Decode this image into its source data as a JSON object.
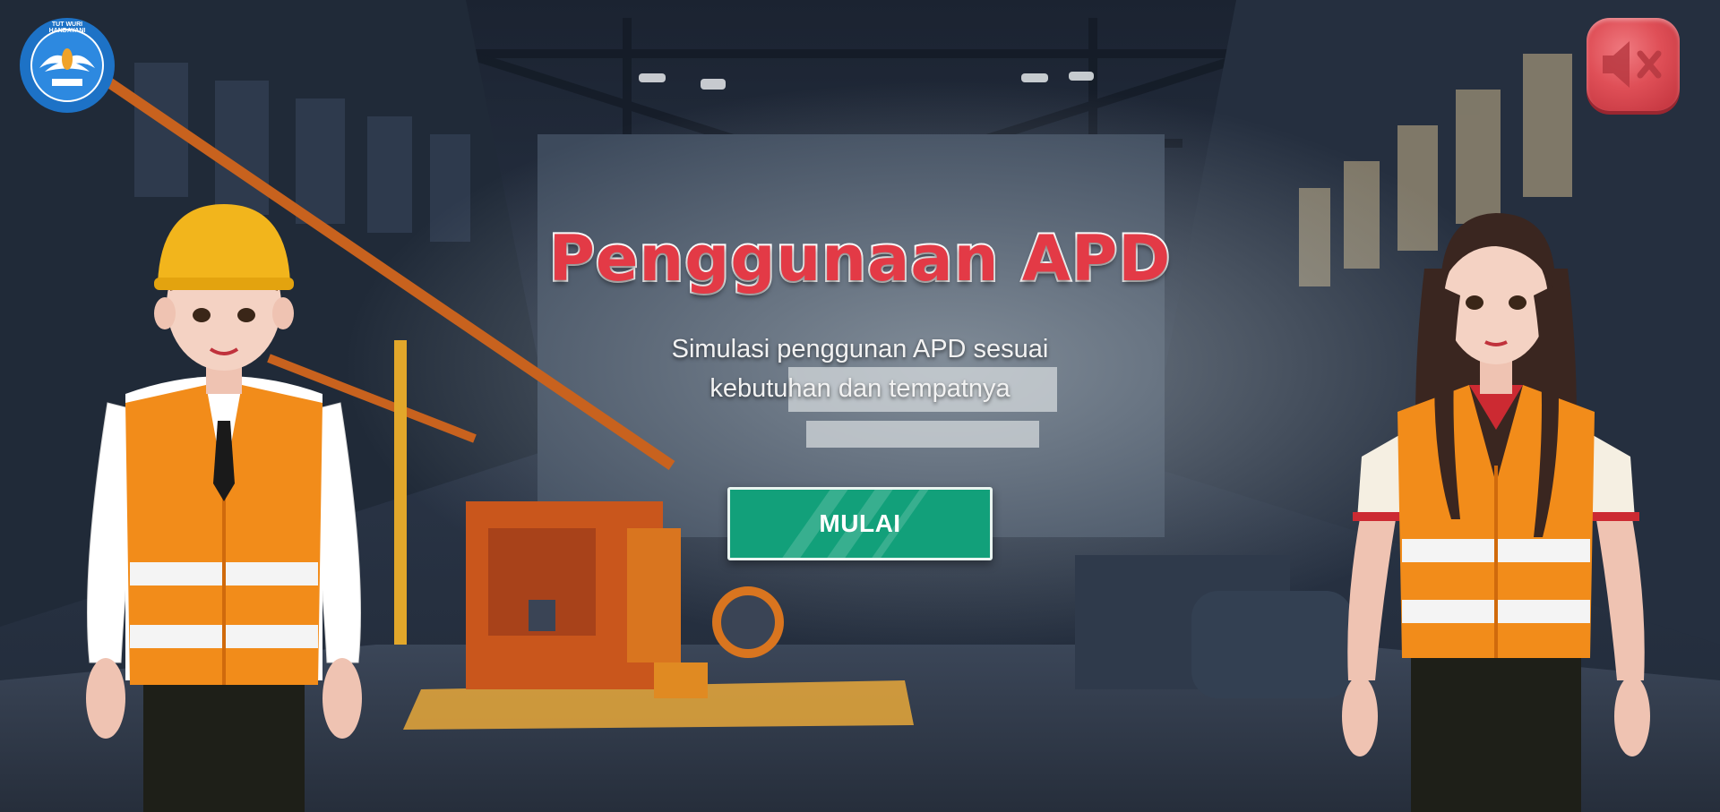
{
  "game": {
    "title": "Penggunaan APD",
    "subtitle_line1": "Simulasi penggunan APD sesuai",
    "subtitle_line2": "kebutuhan dan tempatnya",
    "start_label": "MULAI"
  },
  "logo": {
    "icon": "tut-wuri-handayani-logo",
    "text": "TUT WURI HANDAYANI"
  },
  "audio": {
    "icon": "speaker-muted-icon",
    "state": "muted"
  },
  "colors": {
    "title": "#e33a46",
    "start_button": "#12a07a",
    "mute_button": "#df4f57",
    "vest": "#f28c1a",
    "helmet": "#f2b51c"
  }
}
